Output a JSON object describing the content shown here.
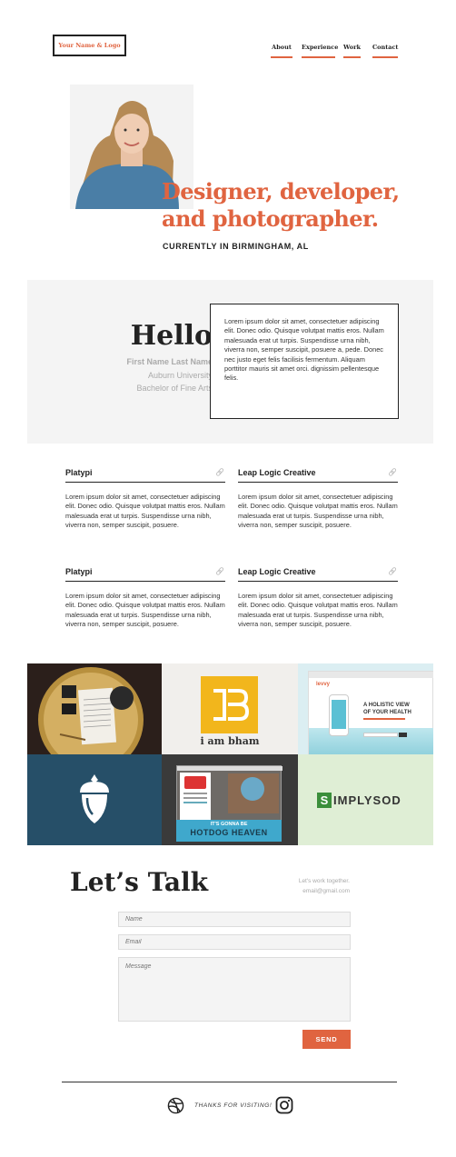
{
  "header": {
    "logo": "Your Name & Logo",
    "nav": [
      {
        "label": "About"
      },
      {
        "label": "Experience"
      },
      {
        "label": "Work"
      },
      {
        "label": "Contact"
      }
    ]
  },
  "hero": {
    "headline_line1": "Designer, developer,",
    "headline_line2": "and photographer.",
    "location": "CURRENTLY IN BIRMINGHAM, AL"
  },
  "about": {
    "greeting": "Hello",
    "name": "First Name Last Name",
    "school": "Auburn University",
    "degree": "Bachelor of Fine Arts",
    "bio": "Lorem ipsum dolor sit amet, consectetuer adipiscing elit. Donec odio. Quisque volutpat mattis eros. Nullam malesuada erat ut turpis. Suspendisse urna nibh, viverra non, semper suscipit, posuere a, pede. Donec nec justo eget felis facilisis fermentum. Aliquam porttitor mauris sit amet orci. dignissim pellentesque felis."
  },
  "experience": [
    {
      "title": "Platypi",
      "description": "Lorem ipsum dolor sit amet, consectetuer adipiscing elit. Donec odio. Quisque volutpat mattis eros. Nullam malesuada erat ut turpis. Suspendisse urna nibh, viverra non, semper suscipit, posuere."
    },
    {
      "title": "Leap Logic Creative",
      "description": "Lorem ipsum dolor sit amet, consectetuer adipiscing elit. Donec odio. Quisque volutpat mattis eros. Nullam malesuada erat ut turpis. Suspendisse urna nibh, viverra non, semper suscipit, posuere."
    },
    {
      "title": "Platypi",
      "description": "Lorem ipsum dolor sit amet, consectetuer adipiscing elit. Donec odio. Quisque volutpat mattis eros. Nullam malesuada erat ut turpis. Suspendisse urna nibh, viverra non, semper suscipit, posuere."
    },
    {
      "title": "Leap Logic Creative",
      "description": "Lorem ipsum dolor sit amet, consectetuer adipiscing elit. Donec odio. Quisque volutpat mattis eros. Nullam malesuada erat ut turpis. Suspendisse urna nibh, viverra non, semper suscipit, posuere."
    }
  ],
  "portfolio": {
    "bham_label": "i am bham",
    "levvy_brand": "levvy",
    "levvy_headline_1": "A HOLISTIC VIEW",
    "levvy_headline_2": "OF YOUR HEALTH",
    "hotdog_line_1": "IT'S GONNA BE",
    "hotdog_line_2": "HOTDOG HEAVEN",
    "simplysod_s": "S",
    "simplysod_rest": "IMPLYSOD"
  },
  "contact": {
    "heading": "Let’s Talk",
    "tagline": "Let's work together.",
    "email": "email@gmail.com",
    "name_placeholder": "Name",
    "email_placeholder": "Email",
    "message_placeholder": "Message",
    "send_label": "SEND"
  },
  "footer": {
    "thanks": "THANKS FOR VISITING!"
  },
  "icons": {
    "link": "link-icon",
    "dribbble": "dribbble-icon",
    "instagram": "instagram-icon"
  },
  "colors": {
    "accent": "#e06440",
    "text": "#222222",
    "muted": "#aaaaaa",
    "panel": "#f4f4f4"
  }
}
